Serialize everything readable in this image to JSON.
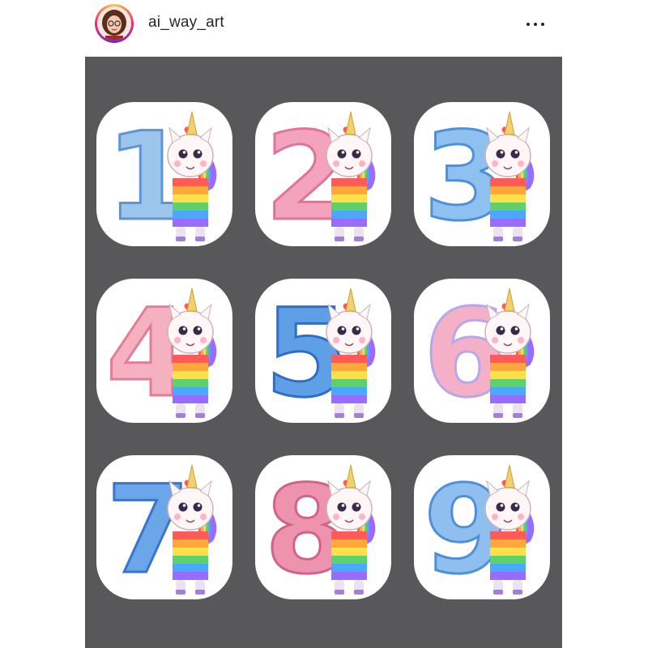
{
  "header": {
    "username": "ai_way_art",
    "avatar": "avatar-girl-glasses",
    "more_icon": "more-horizontal-icon"
  },
  "post": {
    "background_color": "#58585a",
    "stickers": [
      {
        "digit": "1",
        "color": "#9cc5ec",
        "accent": "#5e93d6"
      },
      {
        "digit": "2",
        "color": "#f4a3bd",
        "accent": "#e07498"
      },
      {
        "digit": "3",
        "color": "#8ec1ef",
        "accent": "#4e8fd8"
      },
      {
        "digit": "4",
        "color": "#f6b1c1",
        "accent": "#e37c98"
      },
      {
        "digit": "5",
        "color": "#5f9fe6",
        "accent": "#2f6ec8"
      },
      {
        "digit": "6",
        "color": "#f4b0c7",
        "accent": "#b8a6ec"
      },
      {
        "digit": "7",
        "color": "#6aa6e8",
        "accent": "#3a74cc"
      },
      {
        "digit": "8",
        "color": "#ee93ad",
        "accent": "#d2628a"
      },
      {
        "digit": "9",
        "color": "#8ebfef",
        "accent": "#4f8ed8"
      }
    ]
  }
}
